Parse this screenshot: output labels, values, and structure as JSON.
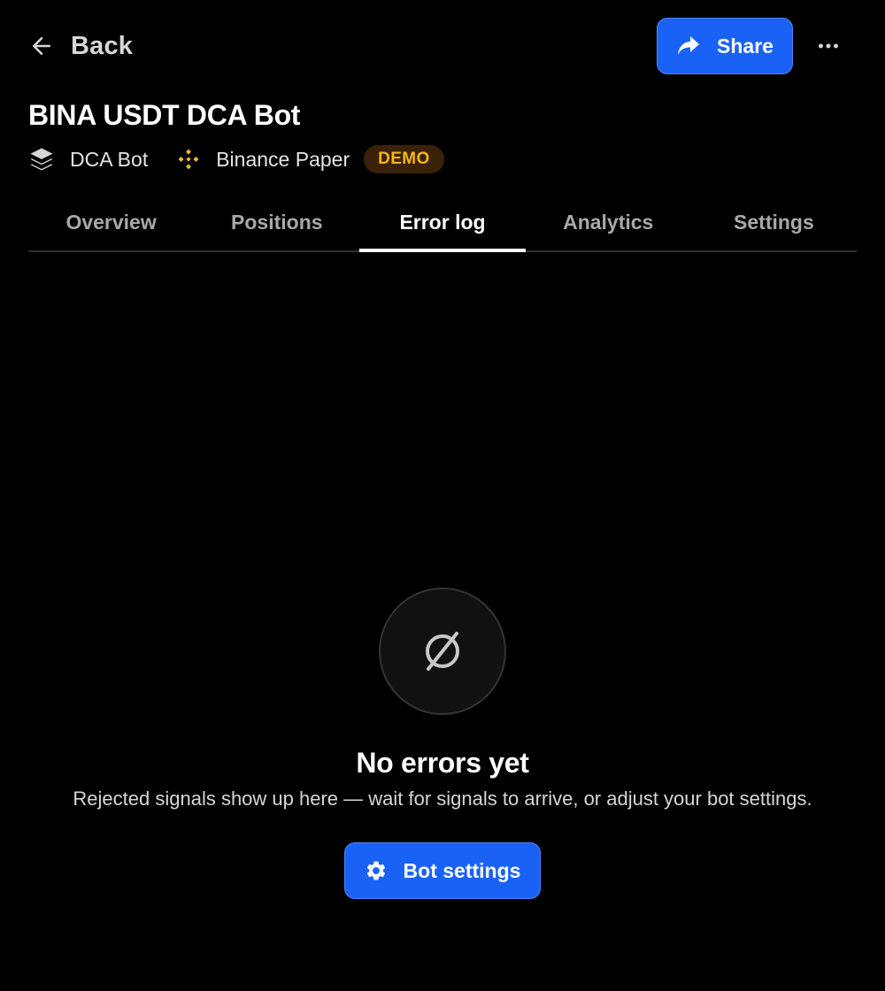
{
  "header": {
    "back_label": "Back",
    "share_label": "Share",
    "back_icon": "arrow-left-icon",
    "share_icon": "share-arrow-icon",
    "more_icon": "more-horizontal-icon"
  },
  "bot": {
    "title": "BINA USDT DCA Bot",
    "type_label": "DCA Bot",
    "type_icon": "layers-icon",
    "exchange_label": "Binance Paper",
    "exchange_icon": "binance-logo-icon",
    "badge": "DEMO"
  },
  "tabs": [
    {
      "label": "Overview",
      "active": false
    },
    {
      "label": "Positions",
      "active": false
    },
    {
      "label": "Error log",
      "active": true
    },
    {
      "label": "Analytics",
      "active": false
    },
    {
      "label": "Settings",
      "active": false
    }
  ],
  "empty_state": {
    "icon": "empty-set-icon",
    "title": "No errors yet",
    "description": "Rejected signals show up here — wait for signals to arrive, or adjust your bot settings.",
    "button_label": "Bot settings",
    "button_icon": "gear-icon"
  },
  "colors": {
    "background": "#000000",
    "primary": "#1a62f5",
    "badge_bg": "#3a2208",
    "badge_text": "#f5b516",
    "binance_yellow": "#f3ba2f"
  }
}
